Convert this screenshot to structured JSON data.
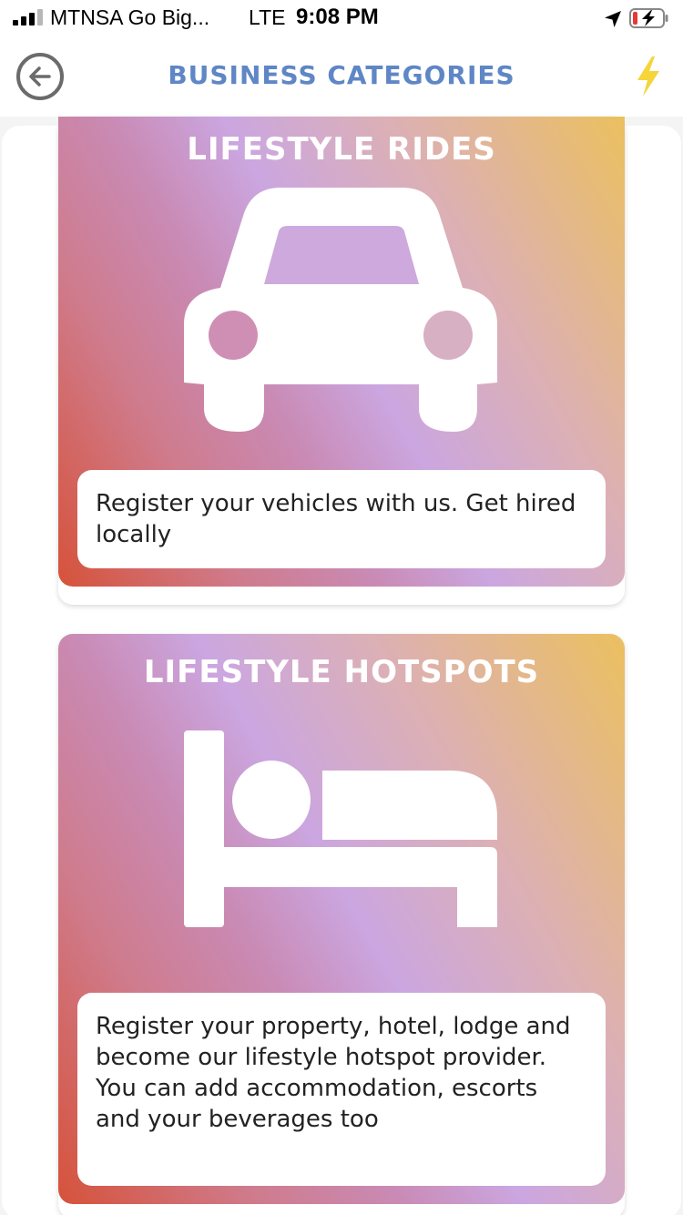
{
  "status_bar": {
    "carrier": "MTNSA Go Big...",
    "network": "LTE",
    "time": "9:08 PM"
  },
  "header": {
    "title": "BUSINESS CATEGORIES",
    "back_icon": "back-arrow-circle-icon",
    "action_icon": "lightning-bolt-icon",
    "title_color": "#5f86c5",
    "bolt_color": "#f5d53a"
  },
  "categories": [
    {
      "title": "LIFESTYLE RIDES",
      "icon": "car-icon",
      "description": "Register your vehicles with us. Get hired locally"
    },
    {
      "title": "LIFESTYLE HOTSPOTS",
      "icon": "bed-icon",
      "description": "Register your property, hotel, lodge and become our lifestyle hotspot provider. You can add accommodation, escorts and your beverages too"
    }
  ],
  "colors": {
    "gradient_start": "#d6523a",
    "gradient_mid": "#cba6e0",
    "gradient_end": "#ebc05f"
  }
}
